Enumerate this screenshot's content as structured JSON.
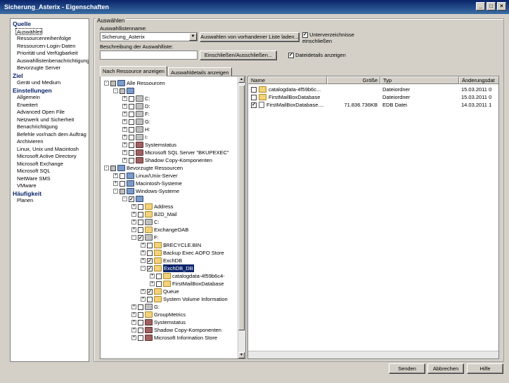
{
  "window": {
    "title": "Sicherung_Asterix - Eigenschaften",
    "controls": [
      "_",
      "□",
      "×"
    ]
  },
  "nav": [
    {
      "type": "cat",
      "label": "Quelle"
    },
    {
      "type": "item",
      "label": "Auswählen",
      "selected": true
    },
    {
      "type": "item",
      "label": "Ressourcenreihenfolge"
    },
    {
      "type": "item",
      "label": "Ressourcen-Login-Daten"
    },
    {
      "type": "item",
      "label": "Priorität und Verfügbarkeit"
    },
    {
      "type": "item",
      "label": "Auswahllistenbenachrichtigung"
    },
    {
      "type": "item",
      "label": "Bevorzugte Server"
    },
    {
      "type": "cat",
      "label": "Ziel"
    },
    {
      "type": "item",
      "label": "Gerät und Medium"
    },
    {
      "type": "cat",
      "label": "Einstellungen"
    },
    {
      "type": "item",
      "label": "Allgemein"
    },
    {
      "type": "item",
      "label": "Erweitert"
    },
    {
      "type": "item",
      "label": "Advanced Open File"
    },
    {
      "type": "item",
      "label": "Netzwerk und Sicherheit"
    },
    {
      "type": "item",
      "label": "Benachrichtigung"
    },
    {
      "type": "item",
      "label": "Befehle vor/nach dem Auftrag"
    },
    {
      "type": "item",
      "label": "Archivieren"
    },
    {
      "type": "item",
      "label": "Linux, Unix und Macintosh"
    },
    {
      "type": "item",
      "label": "Microsoft Active Directory"
    },
    {
      "type": "item",
      "label": "Microsoft Exchange"
    },
    {
      "type": "item",
      "label": "Microsoft SQL"
    },
    {
      "type": "item",
      "label": "NetWare SMS"
    },
    {
      "type": "item",
      "label": "VMware"
    },
    {
      "type": "cat",
      "label": "Häufigkeit"
    },
    {
      "type": "item",
      "label": "Planen"
    }
  ],
  "group": {
    "title": "Auswählen"
  },
  "form": {
    "list_name_label": "Auswahllistenname:",
    "list_name_value": "Sicherung_Asterix",
    "from_list_button": "Auswahlen von vorhandener Liste laden...",
    "subdirs_label": "Unterverzeichnisse einschließen",
    "desc_label": "Beschreibung der Auswahlliste:",
    "desc_value": "",
    "include_button": "Einschließen/Ausschließen...",
    "details_label": "Dateidetails anzeigen"
  },
  "tabs": [
    {
      "label": "Nach Ressource anzeigen",
      "active": true
    },
    {
      "label": "Auswahldetails anzeigen",
      "active": false
    }
  ],
  "tree": [
    {
      "lvl": 0,
      "pm": "-",
      "chk": "part",
      "ico": "pc",
      "label": "Alle Ressourcen"
    },
    {
      "lvl": 1,
      "pm": "-",
      "chk": "part",
      "ico": "pc",
      "label": ""
    },
    {
      "lvl": 2,
      "pm": "+",
      "chk": "off",
      "ico": "drive",
      "label": "C:"
    },
    {
      "lvl": 2,
      "pm": "+",
      "chk": "off",
      "ico": "drive",
      "label": "D:"
    },
    {
      "lvl": 2,
      "pm": "+",
      "chk": "off",
      "ico": "drive",
      "label": "F:"
    },
    {
      "lvl": 2,
      "pm": "+",
      "chk": "off",
      "ico": "drive",
      "label": "G:"
    },
    {
      "lvl": 2,
      "pm": "+",
      "chk": "off",
      "ico": "drive",
      "label": "H:"
    },
    {
      "lvl": 2,
      "pm": "+",
      "chk": "off",
      "ico": "drive",
      "label": "I:"
    },
    {
      "lvl": 2,
      "pm": "+",
      "chk": "off",
      "ico": "srv",
      "label": "Systemstatus"
    },
    {
      "lvl": 2,
      "pm": "+",
      "chk": "off",
      "ico": "srv",
      "label": "Microsoft SQL Server \"BKUPEXEC\""
    },
    {
      "lvl": 2,
      "pm": "+",
      "chk": "off",
      "ico": "srv",
      "label": "Shadow Copy-Komponenten"
    },
    {
      "lvl": 0,
      "pm": "-",
      "chk": "part",
      "ico": "pc",
      "label": "Bevorzugte Ressourcen"
    },
    {
      "lvl": 1,
      "pm": "+",
      "chk": "off",
      "ico": "pc",
      "label": "Linux/Unix-Server"
    },
    {
      "lvl": 1,
      "pm": "+",
      "chk": "off",
      "ico": "pc",
      "label": "Macintosh-Systeme"
    },
    {
      "lvl": 1,
      "pm": "-",
      "chk": "part",
      "ico": "pc",
      "label": "Windows-Systeme"
    },
    {
      "lvl": 2,
      "pm": "-",
      "chk": "on",
      "ico": "pc",
      "label": ""
    },
    {
      "lvl": 3,
      "pm": "+",
      "chk": "off",
      "ico": "folder",
      "label": "Address"
    },
    {
      "lvl": 3,
      "pm": "+",
      "chk": "off",
      "ico": "folder",
      "label": "B2D_Mail"
    },
    {
      "lvl": 3,
      "pm": "+",
      "chk": "off",
      "ico": "drive",
      "label": "C:"
    },
    {
      "lvl": 3,
      "pm": "+",
      "chk": "off",
      "ico": "folder",
      "label": "ExchangeOAB"
    },
    {
      "lvl": 3,
      "pm": "-",
      "chk": "on",
      "ico": "drive",
      "label": "F:"
    },
    {
      "lvl": 4,
      "pm": "+",
      "chk": "off",
      "ico": "folder",
      "label": "$RECYCLE.BIN"
    },
    {
      "lvl": 4,
      "pm": "+",
      "chk": "off",
      "ico": "folder",
      "label": "Backup Exec AOFO Store"
    },
    {
      "lvl": 4,
      "pm": "+",
      "chk": "on",
      "ico": "folder",
      "label": "ExchDB"
    },
    {
      "lvl": 4,
      "pm": "-",
      "chk": "on",
      "ico": "folder",
      "label": "ExchDB_DB",
      "sel": true
    },
    {
      "lvl": 5,
      "pm": "+",
      "chk": "off",
      "ico": "folder",
      "label": "catalogdata-4f59b6c4-"
    },
    {
      "lvl": 5,
      "pm": "+",
      "chk": "off",
      "ico": "folder",
      "label": "FirstMailBoxDatabase"
    },
    {
      "lvl": 4,
      "pm": "+",
      "chk": "on",
      "ico": "folder",
      "label": "Queue"
    },
    {
      "lvl": 4,
      "pm": "+",
      "chk": "off",
      "ico": "folder",
      "label": "System Volume Information"
    },
    {
      "lvl": 3,
      "pm": "+",
      "chk": "off",
      "ico": "drive",
      "label": "G:"
    },
    {
      "lvl": 3,
      "pm": "+",
      "chk": "off",
      "ico": "folder",
      "label": "GroupMetrics"
    },
    {
      "lvl": 3,
      "pm": "+",
      "chk": "off",
      "ico": "srv",
      "label": "Systemstatus"
    },
    {
      "lvl": 3,
      "pm": "+",
      "chk": "off",
      "ico": "srv",
      "label": "Shadow Copy-Komponenten"
    },
    {
      "lvl": 3,
      "pm": "+",
      "chk": "off",
      "ico": "srv",
      "label": "Microsoft Information Store"
    }
  ],
  "list": {
    "columns": [
      "Name",
      "Größe",
      "Typ",
      "Änderungsdat"
    ],
    "rows": [
      {
        "chk": "off",
        "ico": "folder",
        "name": "catalogdata-4f59b6c...",
        "size": "",
        "type": "Dateiordner",
        "date": "15.03.2011 0"
      },
      {
        "chk": "off",
        "ico": "folder",
        "name": "FirstMailBoxDatabase",
        "size": "",
        "type": "Dateiordner",
        "date": "15.03.2011 0"
      },
      {
        "chk": "on",
        "ico": "doc",
        "name": "FirstMailBoxDatabase....",
        "size": "71.836.736KB",
        "type": "EDB Datei",
        "date": "14.03.2011 1"
      }
    ]
  },
  "footer": {
    "send": "Senden",
    "cancel": "Abbrechen",
    "help": "Hilfe"
  }
}
